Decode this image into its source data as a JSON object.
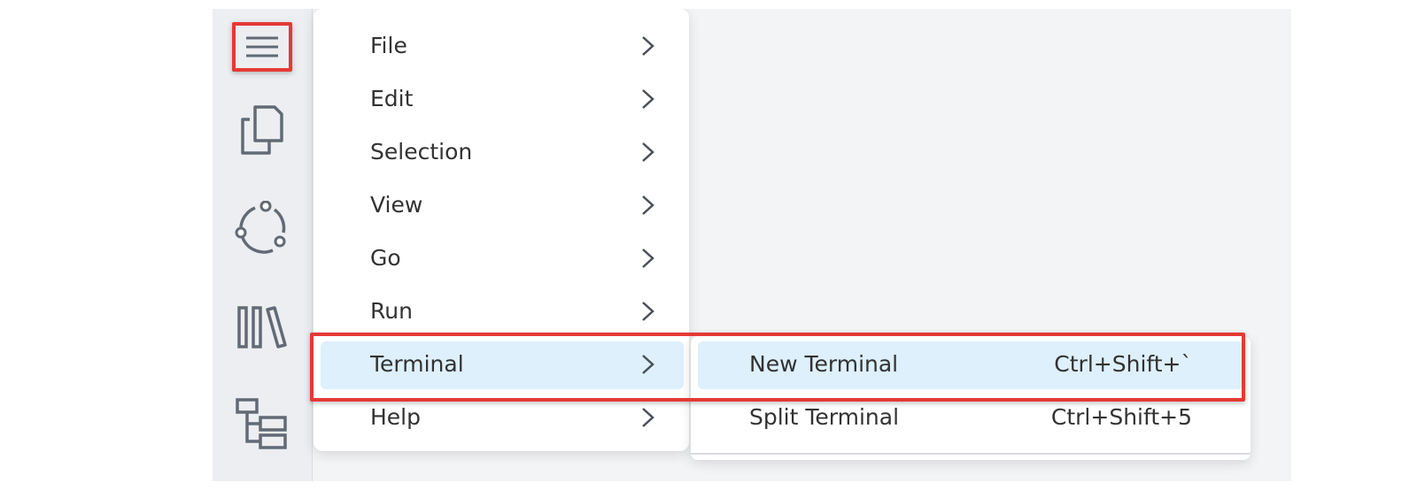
{
  "colors": {
    "highlight_border": "#e53935",
    "active_item_background": "#ddf0fb",
    "icon_color": "#616a75",
    "text_color": "#323232"
  },
  "activity_bar": {
    "items": [
      {
        "name": "menu-toggle",
        "icon": "hamburger-icon"
      },
      {
        "name": "explorer",
        "icon": "files-icon"
      },
      {
        "name": "source-control",
        "icon": "source-control-icon"
      },
      {
        "name": "library",
        "icon": "library-icon"
      },
      {
        "name": "outline",
        "icon": "hierarchy-icon"
      }
    ]
  },
  "menu": {
    "items": [
      {
        "label": "File"
      },
      {
        "label": "Edit"
      },
      {
        "label": "Selection"
      },
      {
        "label": "View"
      },
      {
        "label": "Go"
      },
      {
        "label": "Run"
      },
      {
        "label": "Terminal"
      },
      {
        "label": "Help"
      }
    ],
    "active_label": "Terminal"
  },
  "terminal_submenu": {
    "items": [
      {
        "label": "New Terminal",
        "shortcut": "Ctrl+Shift+`"
      },
      {
        "label": "Split Terminal",
        "shortcut": "Ctrl+Shift+5"
      }
    ],
    "active_label": "New Terminal"
  }
}
